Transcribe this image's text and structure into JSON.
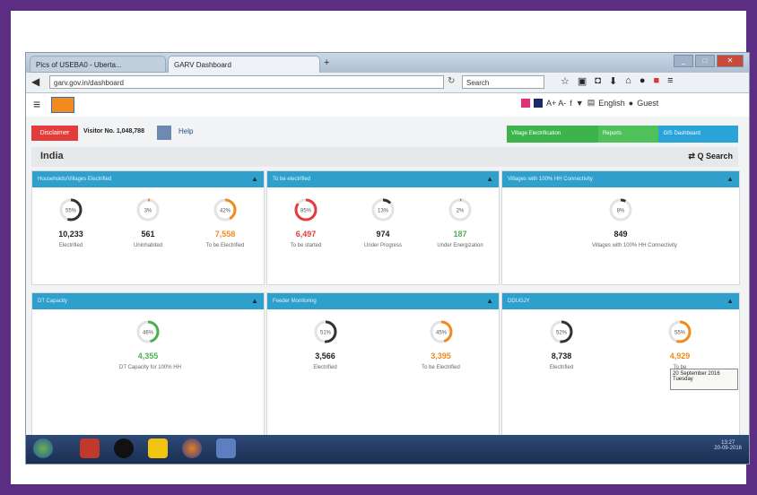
{
  "browser": {
    "tabs": [
      {
        "label": "Pics of USEBA0 - Uberta..."
      },
      {
        "label": "GARV Dashboard"
      }
    ],
    "url": "garv.gov.in/dashboard",
    "search_placeholder": "Search"
  },
  "header": {
    "lang": "English",
    "user": "Guest",
    "access": "A+  A-"
  },
  "toolbar": {
    "red_btn": "Disclaimer",
    "visitor": "Visitor No. 1,048,788",
    "help": "Help",
    "green_items": [
      "Village Electrification",
      "Reports",
      "GIS Dashboard"
    ]
  },
  "title": {
    "region": "India",
    "search": "Search"
  },
  "cards": [
    {
      "head": "Households/Villages Electrified",
      "metrics": [
        {
          "pct": "55%",
          "value": "10,233",
          "label": "Electrified",
          "color": "#333333",
          "frac": 0.55,
          "vcolor": "#222222"
        },
        {
          "pct": "3%",
          "value": "561",
          "label": "Uninhabited",
          "color": "#f28a1e",
          "frac": 0.03,
          "vcolor": "#222222"
        },
        {
          "pct": "42%",
          "value": "7,558",
          "label": "To be Electrified",
          "color": "#f28a1e",
          "frac": 0.42,
          "vcolor": "#f28a1e"
        }
      ]
    },
    {
      "head": "To be electrified",
      "metrics": [
        {
          "pct": "85%",
          "value": "6,497",
          "label": "To be started",
          "color": "#e43b3b",
          "frac": 0.85,
          "vcolor": "#e43b3b"
        },
        {
          "pct": "13%",
          "value": "974",
          "label": "Under Progress",
          "color": "#333333",
          "frac": 0.13,
          "vcolor": "#222222"
        },
        {
          "pct": "2%",
          "value": "187",
          "label": "Under Energization",
          "color": "#4caf50",
          "frac": 0.02,
          "vcolor": "#4caf50"
        }
      ]
    },
    {
      "head": "Villages with 100% HH Connectivity",
      "metrics": [
        {
          "pct": "8%",
          "value": "849",
          "label": "Villages with 100% HH Connectivity",
          "color": "#333333",
          "frac": 0.08,
          "vcolor": "#222222"
        }
      ]
    },
    {
      "head": "DT Capacity",
      "metrics": [
        {
          "pct": "46%",
          "value": "4,355",
          "label": "DT Capacity for 100% HH",
          "color": "#4caf50",
          "frac": 0.46,
          "vcolor": "#4caf50"
        }
      ]
    },
    {
      "head": "Feeder Monitoring",
      "metrics": [
        {
          "pct": "51%",
          "value": "3,566",
          "label": "Electrified",
          "color": "#333333",
          "frac": 0.51,
          "vcolor": "#222222"
        },
        {
          "pct": "45%",
          "value": "3,395",
          "label": "To be Electrified",
          "color": "#f28a1e",
          "frac": 0.45,
          "vcolor": "#f28a1e"
        }
      ]
    },
    {
      "head": "DDUGJY",
      "metrics": [
        {
          "pct": "52%",
          "value": "8,738",
          "label": "Electrified",
          "color": "#333333",
          "frac": 0.52,
          "vcolor": "#222222"
        },
        {
          "pct": "55%",
          "value": "4,929",
          "label": "To be",
          "color": "#f28a1e",
          "frac": 0.55,
          "vcolor": "#f28a1e"
        }
      ]
    }
  ],
  "tooltip": {
    "date": "20 September 2016",
    "day": "Tuesday"
  },
  "clock": {
    "time": "13:27",
    "date": "20-09-2016"
  }
}
